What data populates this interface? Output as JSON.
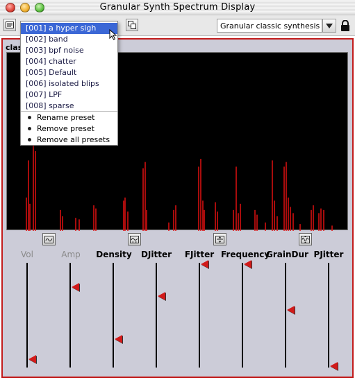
{
  "window": {
    "title": "Granular Synth Spectrum Display"
  },
  "toolbar": {
    "preset_selected": "[001]  a hyper sigh",
    "synth_mode": "Granular classic synthesis",
    "icons": [
      "preset-list-icon",
      "copy-icon",
      "dropdown-arrow-icon",
      "lock-icon"
    ]
  },
  "tab": {
    "label": "clas"
  },
  "preset_menu": {
    "items": [
      "[001]  a hyper sigh",
      "[002]  band",
      "[003]  bpf noise",
      "[004]  chatter",
      "[005]  Default",
      "[006]  isolated blips",
      "[007]  LPF",
      "[008]  sparse"
    ],
    "selected_index": 0,
    "actions": [
      "Rename preset",
      "Remove preset",
      "Remove all presets"
    ]
  },
  "sliders": [
    {
      "label": "Vol",
      "value": 0.08,
      "enabled": false
    },
    {
      "label": "Amp",
      "value": 0.77,
      "enabled": false
    },
    {
      "label": "Density",
      "value": 0.27,
      "enabled": true
    },
    {
      "label": "DJitter",
      "value": 0.68,
      "enabled": true
    },
    {
      "label": "FJitter",
      "value": 0.99,
      "enabled": true
    },
    {
      "label": "Frequency",
      "value": 0.99,
      "enabled": true
    },
    {
      "label": "GrainDur",
      "value": 0.55,
      "enabled": true
    },
    {
      "label": "PJitter",
      "value": 0.01,
      "enabled": true
    }
  ],
  "colors": {
    "frame": "#c21b1b",
    "spectrum_lines": "#e01010",
    "handle": "#d21a1a",
    "menu_highlight": "#3b67d6"
  }
}
